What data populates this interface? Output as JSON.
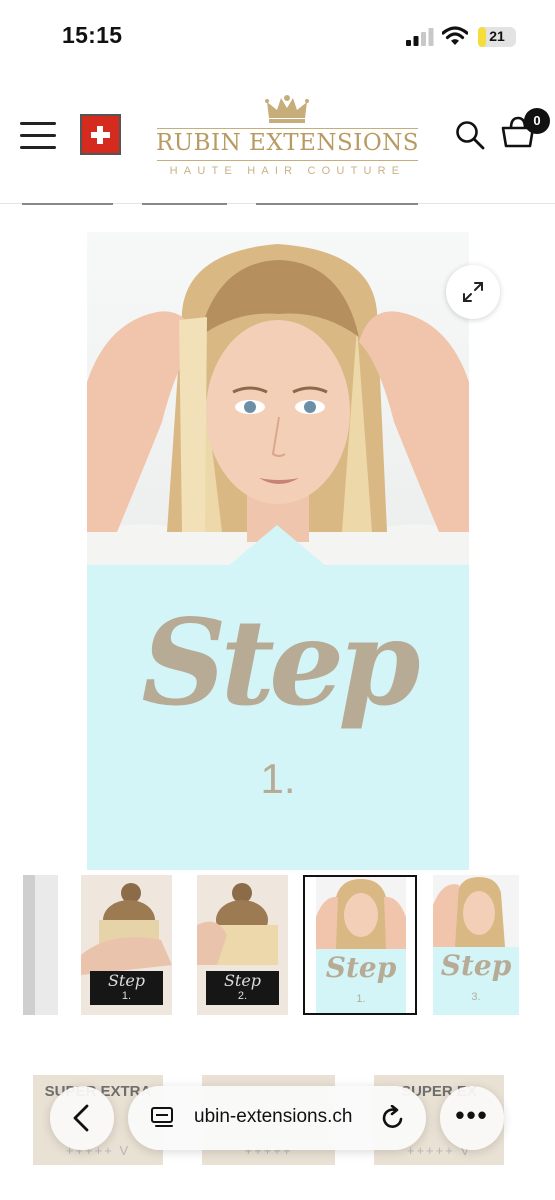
{
  "status_bar": {
    "time": "15:15",
    "battery_level": "21",
    "battery_fraction": 0.21
  },
  "header": {
    "brand_name": "RUBIN EXTENSIONS",
    "brand_tagline": "HAUTE HAIR COUTURE",
    "cart_count": "0",
    "flag_icon": "swiss-flag-icon",
    "accent_color": "#b89b63"
  },
  "product_image": {
    "step_word": "Step",
    "step_number": "1.",
    "panel_color": "#d3f5f7"
  },
  "thumbnails": [
    {
      "step_word": "",
      "step_number": ""
    },
    {
      "step_word": "Step",
      "step_number": "1."
    },
    {
      "step_word": "Step",
      "step_number": "2."
    },
    {
      "step_word": "Step",
      "step_number": "1."
    },
    {
      "step_word": "Step",
      "step_number": "3."
    }
  ],
  "product_strip": [
    {
      "label": "SUPER EXTRA",
      "stars": "+++++ V"
    },
    {
      "label": "",
      "stars": "+++++"
    },
    {
      "label": "SUPER EX",
      "stars": "+++++ V"
    }
  ],
  "toolbar": {
    "address": "ubin-extensions.ch",
    "more_label": "•••"
  }
}
